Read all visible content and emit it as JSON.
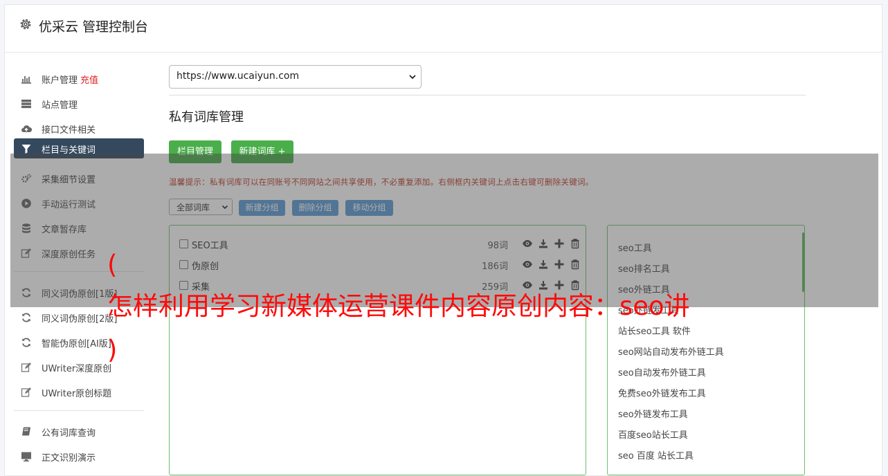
{
  "header": {
    "title": "优采云 管理控制台",
    "icon": "gear-icon"
  },
  "sidebar": {
    "items": [
      {
        "label": "账户管理",
        "badge": "充值",
        "icon": "bar-chart-icon"
      },
      {
        "label": "站点管理",
        "icon": "server-icon"
      },
      {
        "label": "接口文件相关",
        "icon": "cloud-upload-icon"
      },
      {
        "label": "栏目与关键词",
        "icon": "filter-icon",
        "active": true
      },
      {
        "label": "采集细节设置",
        "icon": "gears-icon"
      },
      {
        "label": "手动运行测试",
        "icon": "play-circle-icon"
      },
      {
        "label": "文章暂存库",
        "icon": "database-icon"
      },
      {
        "label": "深度原创任务",
        "icon": "edit-icon"
      },
      {
        "label": "同义词伪原创[1版]",
        "icon": "refresh-icon"
      },
      {
        "label": "同义词伪原创[2版]",
        "icon": "refresh-icon"
      },
      {
        "label": "智能伪原创[AI版]",
        "icon": "refresh-icon"
      },
      {
        "label": "UWriter深度原创",
        "icon": "edit-icon"
      },
      {
        "label": "UWriter原创标题",
        "icon": "edit-icon"
      },
      {
        "label": "公有词库查询",
        "icon": "book-icon"
      },
      {
        "label": "正文识别演示",
        "icon": "monitor-icon"
      }
    ]
  },
  "main": {
    "site_select": {
      "value": "https://www.ucaiyun.com"
    },
    "section_title": "私有词库管理",
    "buttons": {
      "column_manage": "栏目管理",
      "new_library": "新建词库 +"
    },
    "tip": "温馨提示：私有词库可以在同账号不同网站之间共享使用，不必重复添加。右侧框内关键词上点击右键可删除关键词。",
    "group_select": {
      "value": "全部词库"
    },
    "group_buttons": {
      "new_group": "新建分组",
      "delete_group": "删除分组",
      "move_group": "移动分组"
    },
    "libraries": [
      {
        "name": "SEO工具",
        "count": "98词"
      },
      {
        "name": "伪原创",
        "count": "186词"
      },
      {
        "name": "采集",
        "count": "259词"
      }
    ],
    "keywords": [
      "seo工具",
      "seo排名工具",
      "seo外链工具",
      "seo外链发工具",
      "站长seo工具 软件",
      "seo网站自动发布外链工具",
      "seo自动发布外链工具",
      "免费seo外链发布工具",
      "seo外链发布工具",
      "百度seo站长工具",
      "seo 百度 站长工具"
    ]
  },
  "watermark": {
    "line1": "(",
    "line2": "怎样利用学习新媒体运营课件内容原创内容：seo讲",
    "line3": ")"
  },
  "colors": {
    "accent_green": "#4aae4a",
    "accent_blue": "#5b9bd5",
    "sidebar_active": "#34495e",
    "tip_red": "#c0392b",
    "watermark_red": "#ff0a0a"
  }
}
